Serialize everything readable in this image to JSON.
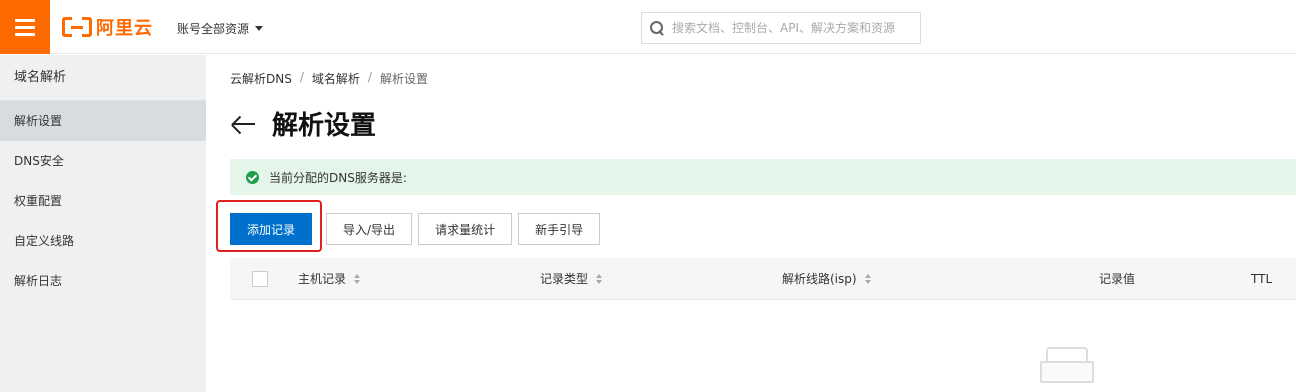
{
  "topbar": {
    "logo_text": "阿里云",
    "account_label": "账号全部资源",
    "search_placeholder": "搜索文档、控制台、API、解决方案和资源"
  },
  "sidebar": {
    "title": "域名解析",
    "items": [
      {
        "label": "解析设置",
        "active": true
      },
      {
        "label": "DNS安全"
      },
      {
        "label": "权重配置"
      },
      {
        "label": "自定义线路"
      },
      {
        "label": "解析日志"
      }
    ]
  },
  "breadcrumb": [
    "云解析DNS",
    "域名解析",
    "解析设置"
  ],
  "breadcrumb_sep": "/",
  "page": {
    "title": "解析设置",
    "notice": "当前分配的DNS服务器是:"
  },
  "buttons": {
    "add_record": "添加记录",
    "import_export": "导入/导出",
    "request_stats": "请求量统计",
    "guide": "新手引导"
  },
  "table": {
    "columns": [
      "主机记录",
      "记录类型",
      "解析线路(isp)",
      "记录值",
      "TTL"
    ]
  },
  "colors": {
    "brand": "#ff6a00",
    "primary_button": "#0070cc",
    "success": "#1e9e4a",
    "highlight": "#e02020"
  }
}
